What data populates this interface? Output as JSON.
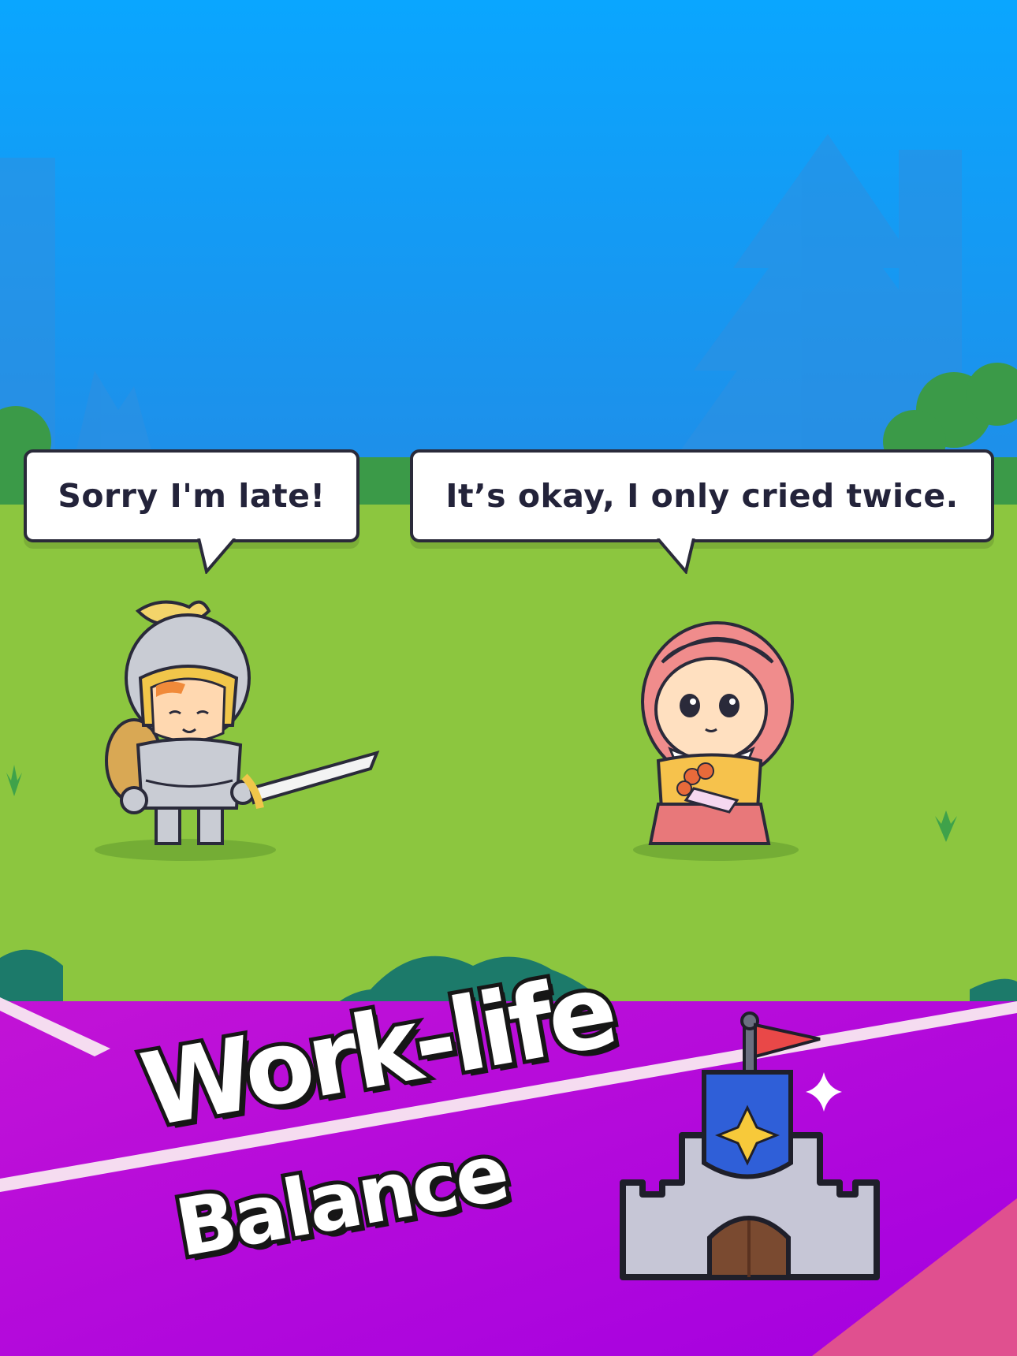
{
  "dialogue": {
    "knight_line": "Sorry I'm late!",
    "lady_line": "It’s okay, I only cried twice."
  },
  "promo": {
    "line1": "Work-life",
    "line2": "Balance"
  },
  "colors": {
    "sky": "#0ea0f6",
    "grass": "#8cc63f",
    "dark_grass": "#3b9a48",
    "teal_bush": "#1c7a6a",
    "magenta": "#b10ad8",
    "pink_corner": "#e0508f"
  },
  "icons": {
    "knight": "knight-character",
    "lady": "lady-character",
    "castle": "castle-icon",
    "sparkle": "sparkle-icon",
    "flag": "red-flag-icon",
    "grass_tuft": "grass-tuft-icon"
  }
}
